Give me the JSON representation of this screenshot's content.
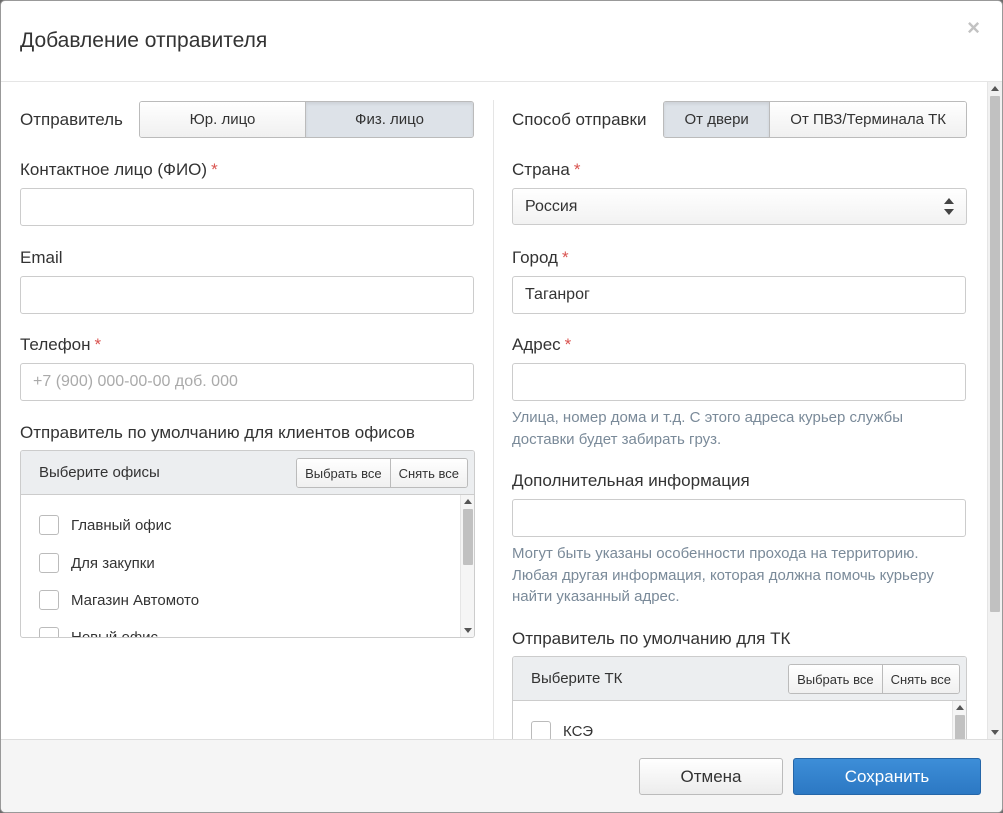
{
  "modal": {
    "title": "Добавление отправителя",
    "close_symbol": "×"
  },
  "left": {
    "sender_label": "Отправитель",
    "sender_options": [
      "Юр. лицо",
      "Физ. лицо"
    ],
    "sender_active": "Физ. лицо",
    "contact_label": "Контактное лицо (ФИО)",
    "contact_value": "",
    "email_label": "Email",
    "email_value": "",
    "phone_label": "Телефон",
    "phone_placeholder": "+7 (900) 000-00-00 доб. 000",
    "default_offices_label": "Отправитель по умолчанию для клиентов офисов",
    "offices_panel": {
      "title": "Выберите офисы",
      "select_all": "Выбрать все",
      "clear_all": "Снять все",
      "items": [
        "Главный офис",
        "Для закупки",
        "Магазин Автомото",
        "Новый офис"
      ]
    }
  },
  "right": {
    "method_label": "Способ отправки",
    "method_options": [
      "От двери",
      "От ПВЗ/Терминала ТК"
    ],
    "method_active": "От двери",
    "country_label": "Страна",
    "country_value": "Россия",
    "city_label": "Город",
    "city_value": "Таганрог",
    "address_label": "Адрес",
    "address_value": "",
    "address_help_1": "Улица, номер дома и т.д. С этого адреса курьер службы",
    "address_help_2": "доставки будет забирать груз.",
    "extra_label": "Дополнительная информация",
    "extra_value": "",
    "extra_help_1": "Могут быть указаны особенности прохода на территорию.",
    "extra_help_2": "Любая другая информация, которая должна помочь курьеру",
    "extra_help_3": "найти указанный адрес.",
    "default_tk_label": "Отправитель по умолчанию для ТК",
    "tk_panel": {
      "title": "Выберите ТК",
      "select_all": "Выбрать все",
      "clear_all": "Снять все",
      "items": [
        "КСЭ"
      ]
    }
  },
  "required_mark": "*",
  "footer": {
    "cancel": "Отмена",
    "save": "Сохранить"
  },
  "colors": {
    "primary": "#2c78c3",
    "required": "#d9534f",
    "help_text": "#7a8a99"
  }
}
